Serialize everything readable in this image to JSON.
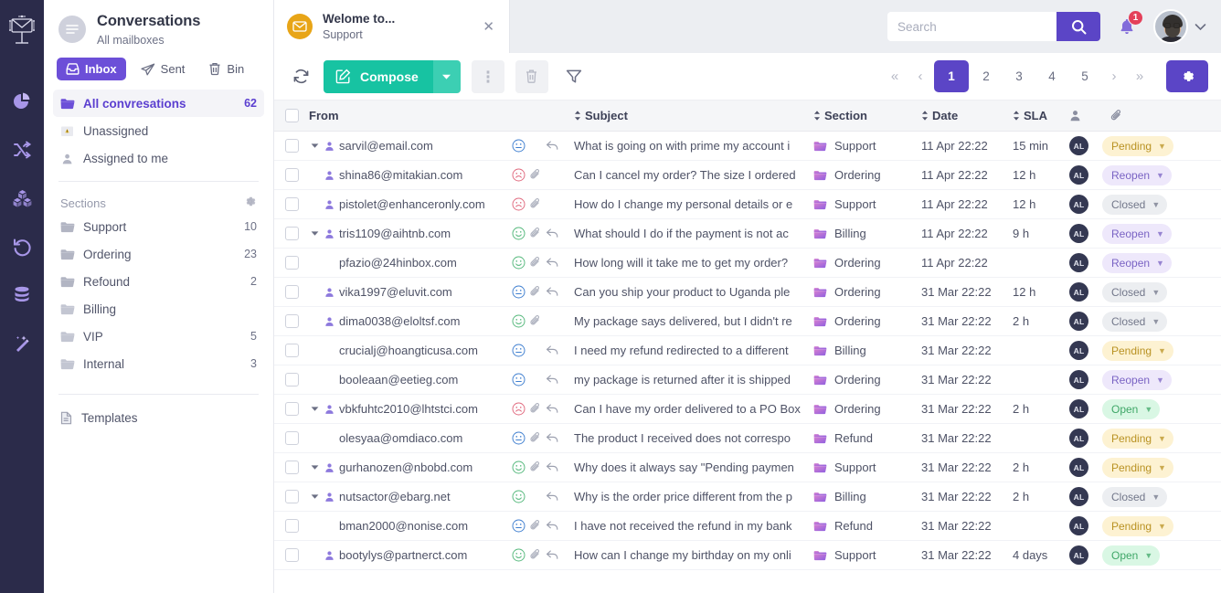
{
  "rail": {
    "logo": "mail-tree-logo",
    "items": [
      {
        "name": "pie-chart-icon"
      },
      {
        "name": "shuffle-icon"
      },
      {
        "name": "boxes-icon"
      },
      {
        "name": "history-icon"
      },
      {
        "name": "database-icon"
      },
      {
        "name": "magic-wand-icon"
      }
    ]
  },
  "sidebar": {
    "title": "Conversations",
    "subtitle": "All mailboxes",
    "tabs": [
      {
        "label": "Inbox",
        "icon": "inbox-icon",
        "active": true
      },
      {
        "label": "Sent",
        "icon": "send-icon",
        "active": false
      },
      {
        "label": "Bin",
        "icon": "trash-icon",
        "active": false
      }
    ],
    "mailboxes": [
      {
        "label": "All convresations",
        "count": "62",
        "icon": "folder-open-icon",
        "active": true
      },
      {
        "label": "Unassigned",
        "count": "",
        "icon": "warning-icon",
        "active": false
      },
      {
        "label": "Assigned to me",
        "count": "",
        "icon": "person-icon",
        "active": false
      }
    ],
    "sections_header": "Sections",
    "sections_gear": "gear-icon",
    "sections": [
      {
        "label": "Support",
        "count": "10"
      },
      {
        "label": "Ordering",
        "count": "23"
      },
      {
        "label": "Refound",
        "count": "2"
      },
      {
        "label": "Billing",
        "count": ""
      },
      {
        "label": "VIP",
        "count": "5"
      },
      {
        "label": "Internal",
        "count": "3"
      }
    ],
    "templates": {
      "label": "Templates",
      "icon": "document-icon"
    }
  },
  "topbar": {
    "conversation_chip": {
      "title": "Welome to...",
      "subtitle": "Support",
      "icon": "envelope-icon",
      "close": "✕"
    },
    "search": {
      "value": "",
      "placeholder": "Search",
      "button_icon": "search-icon"
    },
    "notifications": {
      "icon": "bell-icon",
      "count": "1"
    },
    "account": {
      "avatar": "user-avatar",
      "caret": "chevron-down-icon"
    }
  },
  "toolbar": {
    "refresh_icon": "refresh-icon",
    "compose_label": "Compose",
    "compose_icon": "compose-pencil-icon",
    "compose_caret": "chevron-down-icon",
    "more_icon": "more-vertical-icon",
    "delete_icon": "trash-icon",
    "filter_icon": "filter-icon",
    "settings_icon": "gear-icon",
    "pagination": {
      "first": "«",
      "prev": "‹",
      "next": "›",
      "last": "»",
      "pages": [
        "1",
        "2",
        "3",
        "4",
        "5"
      ],
      "current": "1"
    }
  },
  "table": {
    "columns": [
      {
        "key": "from",
        "label": "From",
        "sortable": false
      },
      {
        "key": "subject",
        "label": "Subject",
        "sortable": true
      },
      {
        "key": "section",
        "label": "Section",
        "sortable": true
      },
      {
        "key": "date",
        "label": "Date",
        "sortable": true
      },
      {
        "key": "sla",
        "label": "SLA",
        "sortable": true
      },
      {
        "key": "user",
        "label": "",
        "icon": "person-icon"
      },
      {
        "key": "attach",
        "label": "",
        "icon": "paperclip-icon"
      }
    ],
    "rows": [
      {
        "expand": true,
        "person": true,
        "from": "sarvil@email.com",
        "mood": "neutral",
        "attach": false,
        "reply": true,
        "subject": "What is going on with prime my account i",
        "section": "Support",
        "date": "11 Apr 22:22",
        "sla": "15 min",
        "user": "AL",
        "status": "Pending",
        "status_key": "pending"
      },
      {
        "expand": false,
        "person": true,
        "from": "shina86@mitakian.com",
        "mood": "sad",
        "attach": true,
        "reply": false,
        "subject": "Can I cancel my order? The size I ordered",
        "section": "Ordering",
        "date": "11 Apr 22:22",
        "sla": "12 h",
        "user": "AL",
        "status": "Reopen",
        "status_key": "reopen"
      },
      {
        "expand": false,
        "person": true,
        "from": "pistolet@enhanceronly.com",
        "mood": "sad",
        "attach": true,
        "reply": false,
        "subject": "How do I change my personal details or e",
        "section": "Support",
        "date": "11 Apr 22:22",
        "sla": "12 h",
        "user": "AL",
        "status": "Closed",
        "status_key": "closed"
      },
      {
        "expand": true,
        "person": true,
        "from": "tris1109@aihtnb.com",
        "mood": "happy",
        "attach": true,
        "reply": true,
        "subject": "What should I do if the payment is not ac",
        "section": "Billing",
        "date": "11 Apr 22:22",
        "sla": "9 h",
        "user": "AL",
        "status": "Reopen",
        "status_key": "reopen"
      },
      {
        "expand": false,
        "person": false,
        "from": "pfazio@24hinbox.com",
        "mood": "happy",
        "attach": true,
        "reply": true,
        "subject": "How long will it take me to get my order?",
        "section": "Ordering",
        "date": "11 Apr 22:22",
        "sla": "",
        "user": "AL",
        "status": "Reopen",
        "status_key": "reopen"
      },
      {
        "expand": false,
        "person": true,
        "from": "vika1997@eluvit.com",
        "mood": "neutral",
        "attach": true,
        "reply": true,
        "subject": "Can you ship your product to Uganda ple",
        "section": "Ordering",
        "date": "31 Mar 22:22",
        "sla": "12 h",
        "user": "AL",
        "status": "Closed",
        "status_key": "closed"
      },
      {
        "expand": false,
        "person": true,
        "from": "dima0038@eloltsf.com",
        "mood": "happy",
        "attach": true,
        "reply": false,
        "subject": "My package says delivered, but I didn't re",
        "section": "Ordering",
        "date": "31 Mar 22:22",
        "sla": "2 h",
        "user": "AL",
        "status": "Closed",
        "status_key": "closed"
      },
      {
        "expand": false,
        "person": false,
        "from": "crucialj@hoangticusa.com",
        "mood": "neutral",
        "attach": false,
        "reply": true,
        "subject": "I need my refund redirected to a different",
        "section": "Billing",
        "date": "31 Mar 22:22",
        "sla": "",
        "user": "AL",
        "status": "Pending",
        "status_key": "pending"
      },
      {
        "expand": false,
        "person": false,
        "from": "booleaan@eetieg.com",
        "mood": "neutral",
        "attach": false,
        "reply": true,
        "subject": " my package is returned after it is shipped",
        "section": "Ordering",
        "date": "31 Mar 22:22",
        "sla": "",
        "user": "AL",
        "status": "Reopen",
        "status_key": "reopen"
      },
      {
        "expand": true,
        "person": true,
        "from": "vbkfuhtc2010@lhtstci.com",
        "mood": "sad",
        "attach": true,
        "reply": true,
        "subject": "Can I have my order delivered to a PO Box",
        "section": "Ordering",
        "date": "31 Mar 22:22",
        "sla": "2 h",
        "user": "AL",
        "status": "Open",
        "status_key": "open"
      },
      {
        "expand": false,
        "person": false,
        "from": "olesyaa@omdiaco.com",
        "mood": "neutral",
        "attach": true,
        "reply": true,
        "subject": "The product I received does not correspo",
        "section": "Refund",
        "date": "31 Mar 22:22",
        "sla": "",
        "user": "AL",
        "status": "Pending",
        "status_key": "pending"
      },
      {
        "expand": true,
        "person": true,
        "from": "gurhanozen@nbobd.com",
        "mood": "happy",
        "attach": true,
        "reply": true,
        "subject": "Why does it always say \"Pending paymen",
        "section": "Support",
        "date": "31 Mar 22:22",
        "sla": "2 h",
        "user": "AL",
        "status": "Pending",
        "status_key": "pending"
      },
      {
        "expand": true,
        "person": true,
        "from": "nutsactor@ebarg.net",
        "mood": "happy",
        "attach": false,
        "reply": true,
        "subject": "Why is the order price different from the p",
        "section": "Billing",
        "date": "31 Mar 22:22",
        "sla": "2 h",
        "user": "AL",
        "status": "Closed",
        "status_key": "closed"
      },
      {
        "expand": false,
        "person": false,
        "from": "bman2000@nonise.com",
        "mood": "neutral",
        "attach": true,
        "reply": true,
        "subject": "I have not received the refund in my bank",
        "section": "Refund",
        "date": "31 Mar 22:22",
        "sla": "",
        "user": "AL",
        "status": "Pending",
        "status_key": "pending"
      },
      {
        "expand": false,
        "person": true,
        "from": "bootylys@partnerct.com",
        "mood": "happy",
        "attach": true,
        "reply": true,
        "subject": "How can I change my birthday on my onli",
        "section": "Support",
        "date": "31 Mar 22:22",
        "sla": "4 days",
        "user": "AL",
        "status": "Open",
        "status_key": "open"
      }
    ]
  },
  "colors": {
    "rail_bg": "#2b2b4a",
    "accent_purple": "#5b45c6",
    "compose_green": "#17c3a2",
    "badge_pending": "#fdf2d2",
    "badge_reopen": "#eee8fb",
    "badge_closed": "#eceef1",
    "badge_open": "#d9f7e4",
    "notification_red": "#e4405a",
    "envelope_yellow": "#e8a517"
  }
}
